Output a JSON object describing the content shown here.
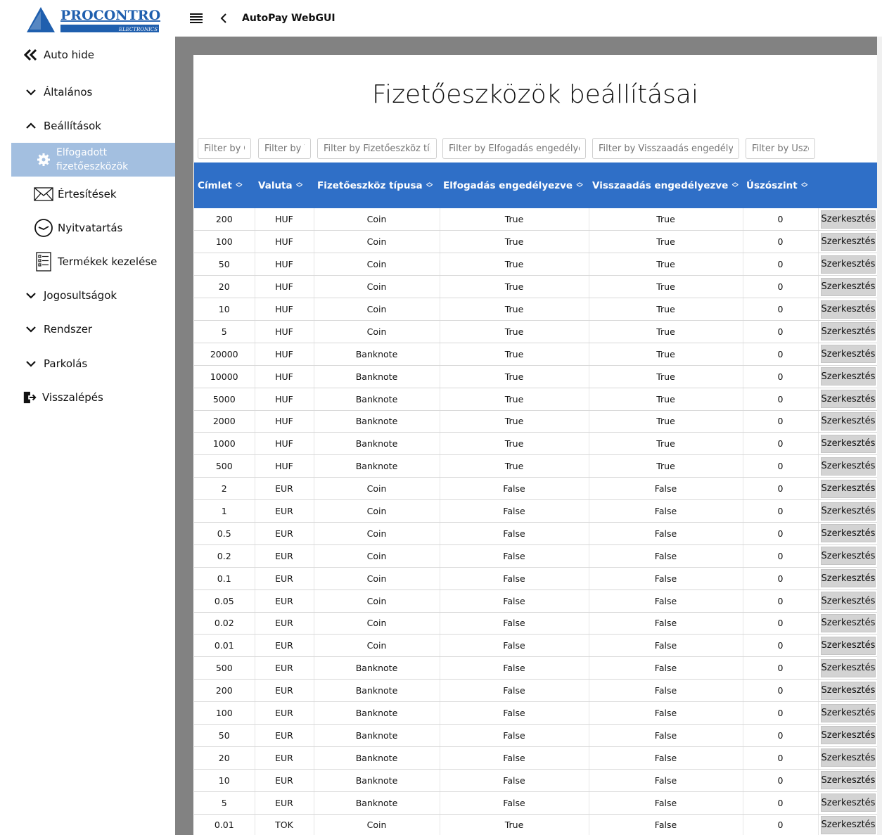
{
  "brand": {
    "name": "PROCONTROL",
    "sub": "ELECTRONICS"
  },
  "topbar": {
    "title": "AutoPay WebGUI"
  },
  "sidebar": {
    "auto_hide": "Auto hide",
    "items": [
      {
        "label": "Általános"
      },
      {
        "label": "Beállítások"
      },
      {
        "label": "Elfogadott fizetőeszközök"
      },
      {
        "label": "Értesítések"
      },
      {
        "label": "Nyitvatartás"
      },
      {
        "label": "Termékek kezelése"
      },
      {
        "label": "Jogosultságok"
      },
      {
        "label": "Rendszer"
      },
      {
        "label": "Parkolás"
      },
      {
        "label": "Visszalépés"
      }
    ]
  },
  "page": {
    "title": "Fizetőeszközök beállításai"
  },
  "filters": [
    "Filter by Címlet",
    "Filter by Valuta",
    "Filter by Fizetőeszköz típusa",
    "Filter by Elfogadás engedélyezve",
    "Filter by Visszaadás engedélyezve",
    "Filter by Úszószint"
  ],
  "table": {
    "columns": [
      "Címlet",
      "Valuta",
      "Fizetőeszköz típusa",
      "Elfogadás engedélyezve",
      "Visszaadás engedélyezve",
      "Úszószint"
    ],
    "edit_label": "Szerkesztés",
    "rows": [
      [
        "200",
        "HUF",
        "Coin",
        "True",
        "True",
        "0"
      ],
      [
        "100",
        "HUF",
        "Coin",
        "True",
        "True",
        "0"
      ],
      [
        "50",
        "HUF",
        "Coin",
        "True",
        "True",
        "0"
      ],
      [
        "20",
        "HUF",
        "Coin",
        "True",
        "True",
        "0"
      ],
      [
        "10",
        "HUF",
        "Coin",
        "True",
        "True",
        "0"
      ],
      [
        "5",
        "HUF",
        "Coin",
        "True",
        "True",
        "0"
      ],
      [
        "20000",
        "HUF",
        "Banknote",
        "True",
        "True",
        "0"
      ],
      [
        "10000",
        "HUF",
        "Banknote",
        "True",
        "True",
        "0"
      ],
      [
        "5000",
        "HUF",
        "Banknote",
        "True",
        "True",
        "0"
      ],
      [
        "2000",
        "HUF",
        "Banknote",
        "True",
        "True",
        "0"
      ],
      [
        "1000",
        "HUF",
        "Banknote",
        "True",
        "True",
        "0"
      ],
      [
        "500",
        "HUF",
        "Banknote",
        "True",
        "True",
        "0"
      ],
      [
        "2",
        "EUR",
        "Coin",
        "False",
        "False",
        "0"
      ],
      [
        "1",
        "EUR",
        "Coin",
        "False",
        "False",
        "0"
      ],
      [
        "0.5",
        "EUR",
        "Coin",
        "False",
        "False",
        "0"
      ],
      [
        "0.2",
        "EUR",
        "Coin",
        "False",
        "False",
        "0"
      ],
      [
        "0.1",
        "EUR",
        "Coin",
        "False",
        "False",
        "0"
      ],
      [
        "0.05",
        "EUR",
        "Coin",
        "False",
        "False",
        "0"
      ],
      [
        "0.02",
        "EUR",
        "Coin",
        "False",
        "False",
        "0"
      ],
      [
        "0.01",
        "EUR",
        "Coin",
        "False",
        "False",
        "0"
      ],
      [
        "500",
        "EUR",
        "Banknote",
        "False",
        "False",
        "0"
      ],
      [
        "200",
        "EUR",
        "Banknote",
        "False",
        "False",
        "0"
      ],
      [
        "100",
        "EUR",
        "Banknote",
        "False",
        "False",
        "0"
      ],
      [
        "50",
        "EUR",
        "Banknote",
        "False",
        "False",
        "0"
      ],
      [
        "20",
        "EUR",
        "Banknote",
        "False",
        "False",
        "0"
      ],
      [
        "10",
        "EUR",
        "Banknote",
        "False",
        "False",
        "0"
      ],
      [
        "5",
        "EUR",
        "Banknote",
        "False",
        "False",
        "0"
      ],
      [
        "0.01",
        "TOK",
        "Coin",
        "True",
        "False",
        "0"
      ]
    ]
  },
  "colors": {
    "accent": "#2f6fc7",
    "active_nav": "#a3bfe0",
    "content_bg": "#828282",
    "logo": "#1f5fae"
  }
}
